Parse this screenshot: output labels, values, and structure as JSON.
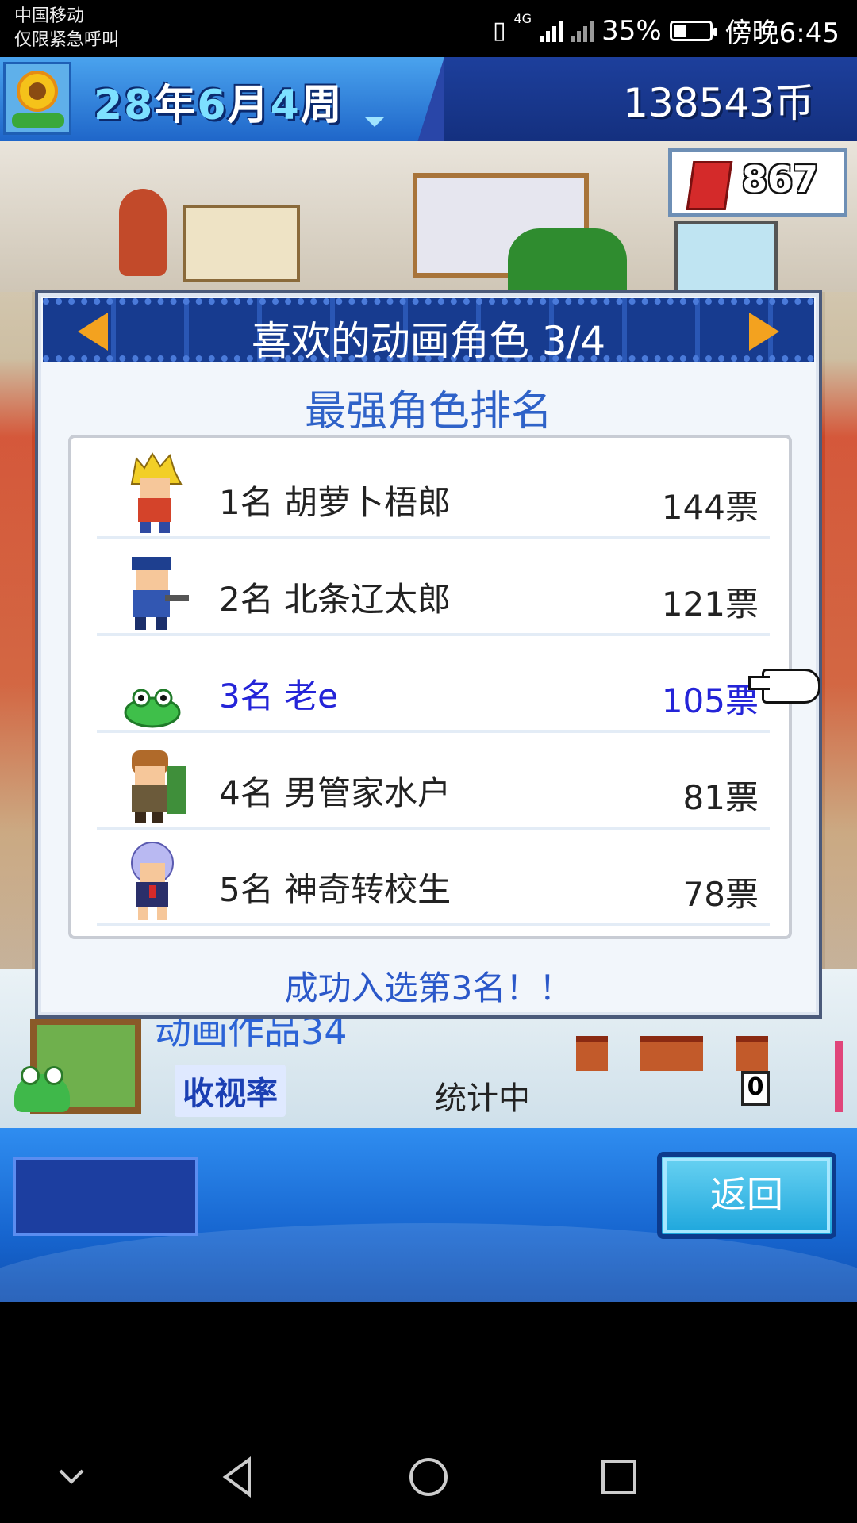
{
  "status_bar": {
    "carrier_line1": "中国移动",
    "carrier_line2": "仅限紧急呼叫",
    "network": "4G",
    "battery": "35%",
    "battery_level": 0.35,
    "time": "傍晚6:45"
  },
  "game_header": {
    "year": "28",
    "year_unit": "年",
    "month": "6",
    "month_unit": "月",
    "week": "4",
    "week_unit": "周",
    "coins": "138543币",
    "stat_value": "867"
  },
  "dialog": {
    "title": "喜欢的动画角色 3/4",
    "subtitle": "最强角色排名",
    "message": "成功入选第3名！！",
    "rankings": [
      {
        "rank_name": "1名 胡萝卜梧郎",
        "votes": "144票"
      },
      {
        "rank_name": "2名 北条辽太郎",
        "votes": "121票"
      },
      {
        "rank_name": "3名 老e",
        "votes": "105票"
      },
      {
        "rank_name": "4名 男管家水户",
        "votes": "81票"
      },
      {
        "rank_name": "5名 神奇转校生",
        "votes": "78票"
      }
    ]
  },
  "background_info": {
    "anime_title": "动画作品34",
    "ratings_label": "收视率",
    "status": "统计中",
    "count": "0"
  },
  "bottom_bar": {
    "back_label": "返回"
  },
  "colors": {
    "highlight_text": "#2424d8",
    "title_blue": "#2f62c8",
    "accent_orange": "#f3a21f"
  }
}
